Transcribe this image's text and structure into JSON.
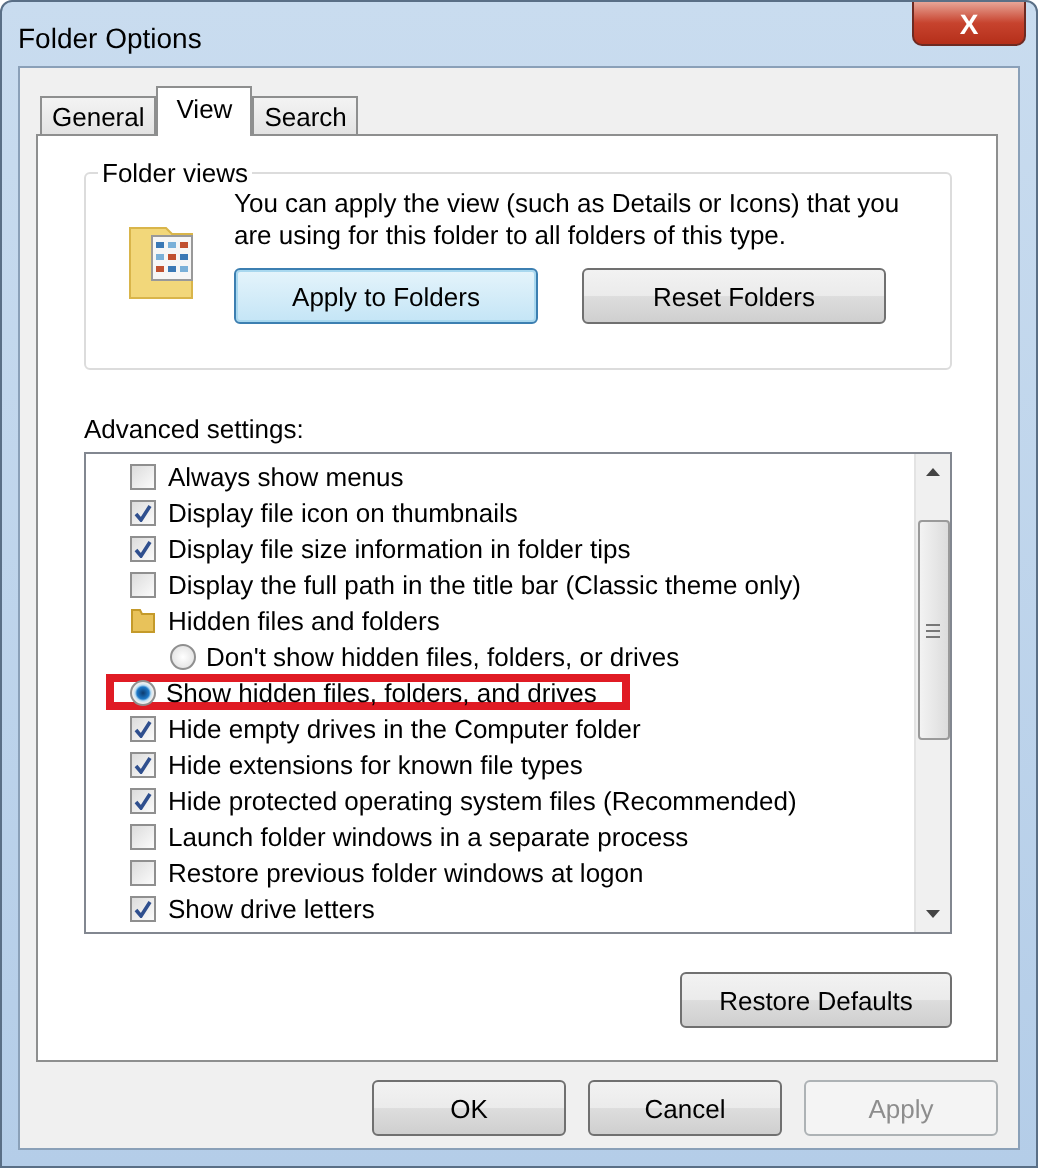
{
  "window": {
    "title": "Folder Options",
    "close": "X"
  },
  "tabs": [
    {
      "label": "General",
      "selected": false
    },
    {
      "label": "View",
      "selected": true
    },
    {
      "label": "Search",
      "selected": false
    }
  ],
  "folder_views": {
    "title": "Folder views",
    "description": "You can apply the view (such as Details or Icons) that you are using for this folder to all folders of this type.",
    "buttons": [
      {
        "label": "Apply to Folders",
        "focused": true
      },
      {
        "label": "Reset Folders",
        "focused": false
      }
    ]
  },
  "advanced": {
    "label": "Advanced settings:",
    "items": [
      {
        "kind": "checkbox",
        "label": "Always show menus",
        "checked": false
      },
      {
        "kind": "checkbox",
        "label": "Display file icon on thumbnails",
        "checked": true
      },
      {
        "kind": "checkbox",
        "label": "Display file size information in folder tips",
        "checked": true
      },
      {
        "kind": "checkbox",
        "label": "Display the full path in the title bar (Classic theme only)",
        "checked": false
      },
      {
        "kind": "group",
        "label": "Hidden files and folders",
        "children": [
          {
            "kind": "radio",
            "label": "Don't show hidden files, folders, or drives",
            "selected": false,
            "highlighted": false
          },
          {
            "kind": "radio",
            "label": "Show hidden files, folders, and drives",
            "selected": true,
            "highlighted": true
          }
        ]
      },
      {
        "kind": "checkbox",
        "label": "Hide empty drives in the Computer folder",
        "checked": true
      },
      {
        "kind": "checkbox",
        "label": "Hide extensions for known file types",
        "checked": true
      },
      {
        "kind": "checkbox",
        "label": "Hide protected operating system files (Recommended)",
        "checked": true
      },
      {
        "kind": "checkbox",
        "label": "Launch folder windows in a separate process",
        "checked": false
      },
      {
        "kind": "checkbox",
        "label": "Restore previous folder windows at logon",
        "checked": false
      },
      {
        "kind": "checkbox",
        "label": "Show drive letters",
        "checked": true
      }
    ],
    "restore": "Restore Defaults"
  },
  "buttons": [
    {
      "label": "OK",
      "disabled": false
    },
    {
      "label": "Cancel",
      "disabled": false
    },
    {
      "label": "Apply",
      "disabled": true
    }
  ]
}
